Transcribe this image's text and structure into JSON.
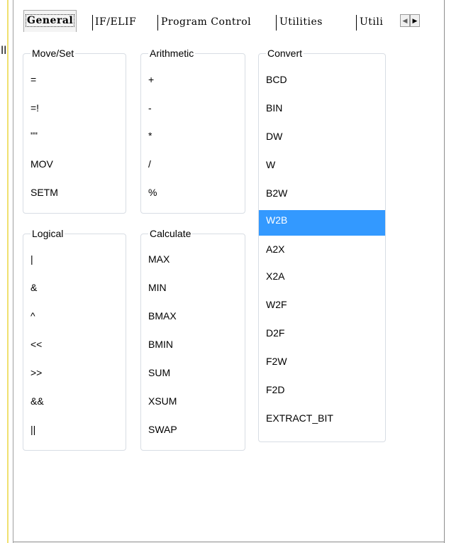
{
  "tabs": [
    {
      "label": "General",
      "active": true
    },
    {
      "label": "IF/ELIF",
      "active": false
    },
    {
      "label": "Program Control",
      "active": false
    },
    {
      "label": "Utilities",
      "active": false
    },
    {
      "label": "Utili",
      "active": false
    }
  ],
  "scroll": {
    "left_icon": "◀",
    "right_icon": "▶"
  },
  "side_glyph": "ll",
  "groups": {
    "move_set": {
      "title": "Move/Set",
      "items": [
        "=",
        "=!",
        "\"\"",
        "MOV",
        "SETM"
      ]
    },
    "arithmetic": {
      "title": "Arithmetic",
      "items": [
        "+",
        "-",
        "*",
        "/",
        "%"
      ]
    },
    "convert": {
      "title": "Convert",
      "items": [
        "BCD",
        "BIN",
        "DW",
        "W",
        "B2W",
        "W2B",
        "A2X",
        "X2A",
        "W2F",
        "D2F",
        "F2W",
        "F2D",
        "EXTRACT_BIT"
      ],
      "selected": "W2B"
    },
    "logical": {
      "title": "Logical",
      "items": [
        "|",
        "&",
        "^",
        "<<",
        ">>",
        "&&",
        "||"
      ]
    },
    "calculate": {
      "title": "Calculate",
      "items": [
        "MAX",
        "MIN",
        "BMAX",
        "BMIN",
        "SUM",
        "XSUM",
        "SWAP"
      ]
    }
  },
  "colors": {
    "selection": "#3399ff",
    "group_border": "#d8dde4"
  }
}
